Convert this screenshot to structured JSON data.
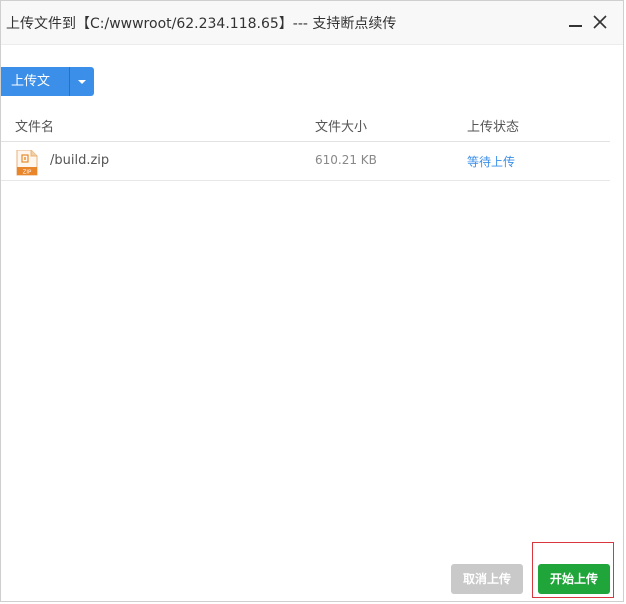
{
  "dialog": {
    "title": "上传文件到【C:/wwwroot/62.234.118.65】--- 支持断点续传",
    "minimize_icon": "minimize-icon",
    "close_icon": "close-icon"
  },
  "toolbar": {
    "upload_label": "上传文件",
    "dropdown_icon": "caret-down-icon"
  },
  "table": {
    "columns": [
      "文件名",
      "文件大小",
      "上传状态"
    ],
    "rows": [
      {
        "icon": "zip-file-icon",
        "name": "/build.zip",
        "size": "610.21 KB",
        "status": "等待上传"
      }
    ]
  },
  "actions": {
    "cancel_label": "取消上传",
    "start_label": "开始上传"
  },
  "colors": {
    "accent_blue": "#3b8fe8",
    "start_green": "#20a53a",
    "highlight_red": "#d9363e",
    "disabled_gray": "#c9c9c9"
  }
}
